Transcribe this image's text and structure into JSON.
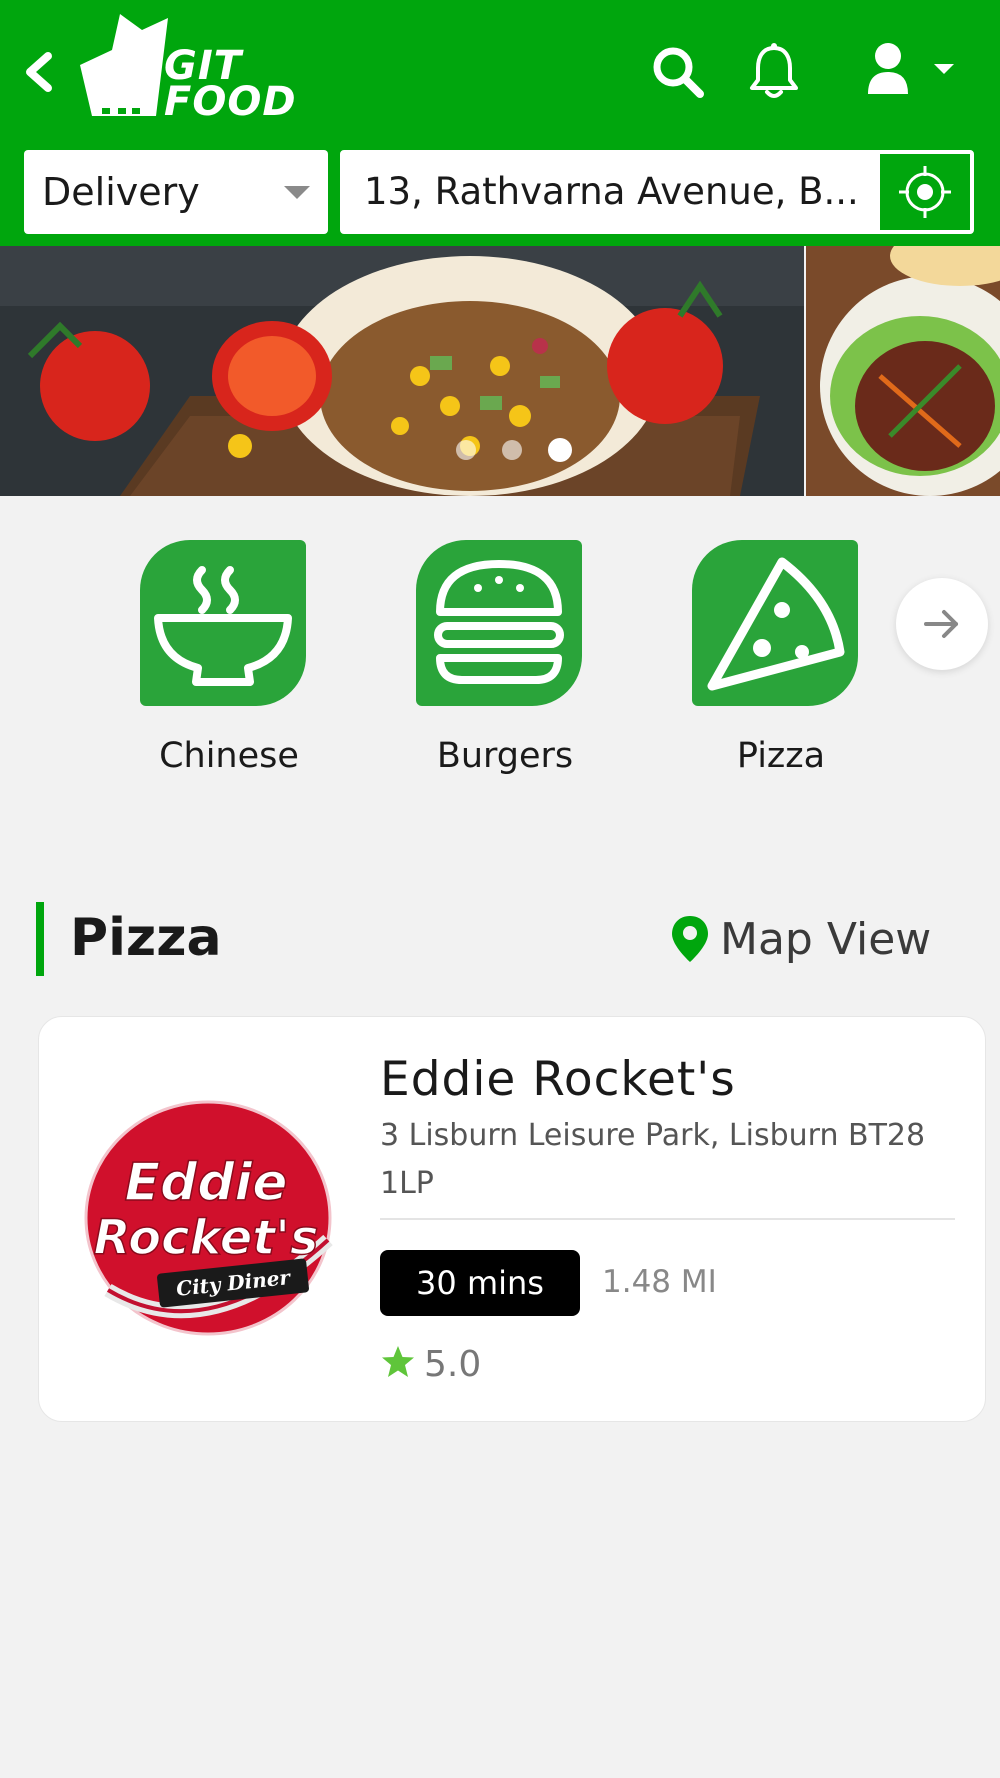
{
  "header": {
    "logo_line1": "GIT",
    "logo_line2": "FOOD",
    "order_type": "Delivery",
    "address": "13, Rathvarna Avenue, B..."
  },
  "banner": {
    "slides": 3,
    "active_slide": 3
  },
  "categories": [
    {
      "label": "Chinese",
      "icon": "bowl-icon"
    },
    {
      "label": "Burgers",
      "icon": "burger-icon"
    },
    {
      "label": "Pizza",
      "icon": "pizza-slice-icon"
    }
  ],
  "section": {
    "title": "Pizza",
    "map_view_label": "Map View"
  },
  "restaurant": {
    "name": "Eddie Rocket's",
    "address": "3 Lisburn Leisure Park, Lisburn BT28 1LP",
    "delivery_time": "30 mins",
    "distance": "1.48 MI",
    "rating": "5.0",
    "logo_line1": "Eddie",
    "logo_line2": "Rocket's",
    "logo_tagline": "City Diner"
  },
  "colors": {
    "brand_green": "#00a60d",
    "category_green": "#2aa43a",
    "star_green": "#5fc53a",
    "logo_red": "#d0102c"
  }
}
